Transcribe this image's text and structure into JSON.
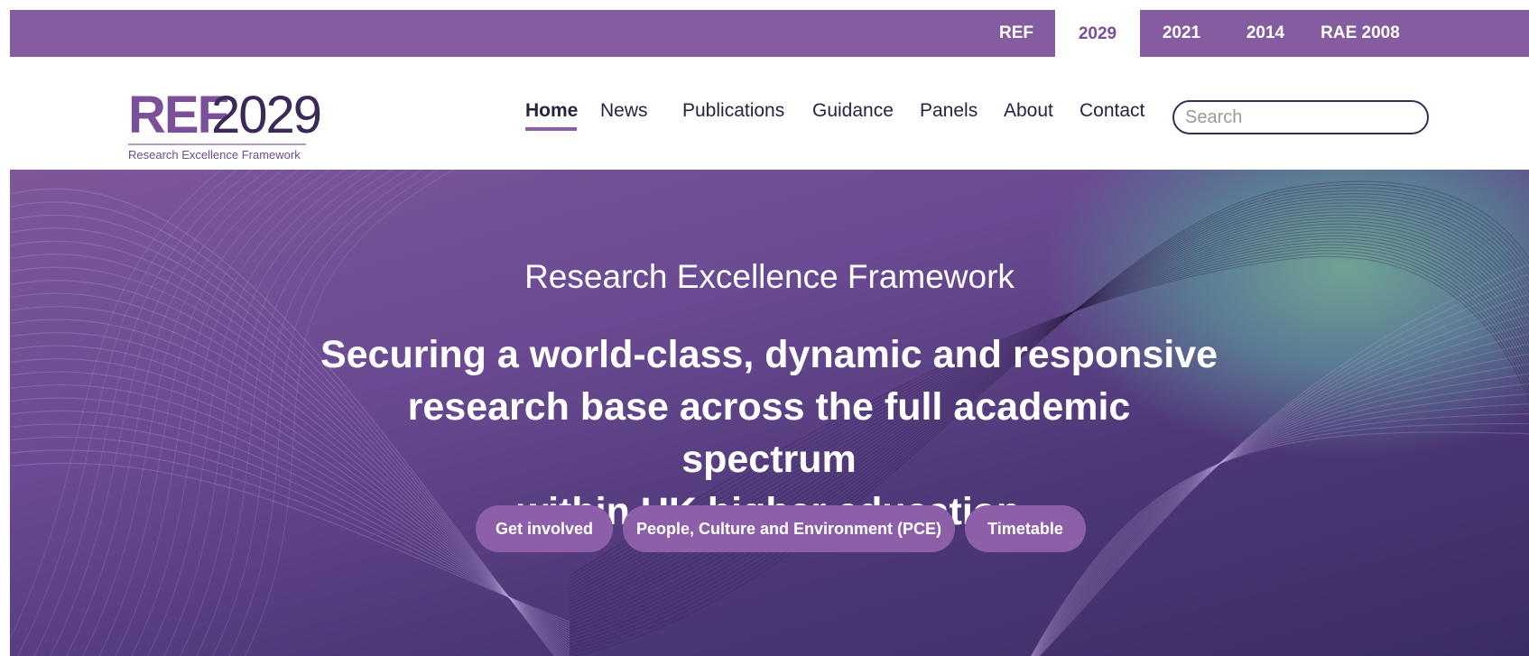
{
  "topbar": {
    "tabs": [
      {
        "label": "REF"
      },
      {
        "label": "2029"
      },
      {
        "label": "2021"
      },
      {
        "label": "2014"
      },
      {
        "label": "RAE 2008"
      }
    ],
    "active_tab": "2029"
  },
  "logo": {
    "ref": "REF",
    "year": "2029",
    "tagline": "Research Excellence Framework"
  },
  "nav": {
    "items": [
      {
        "label": "Home"
      },
      {
        "label": "News"
      },
      {
        "label": "Publications"
      },
      {
        "label": "Guidance"
      },
      {
        "label": "Panels"
      },
      {
        "label": "About"
      },
      {
        "label": "Contact"
      }
    ],
    "active": "Home"
  },
  "search": {
    "placeholder": "Search",
    "value": ""
  },
  "hero": {
    "subtitle": "Research Excellence Framework",
    "headline_lines": [
      "Securing a world-class, dynamic and responsive",
      "research base across the full academic spectrum",
      "within UK higher education"
    ],
    "buttons": [
      {
        "label": "Get involved"
      },
      {
        "label": "People, Culture and Environment (PCE)"
      },
      {
        "label": "Timetable"
      }
    ]
  },
  "colors": {
    "brand_purple": "#855c9f",
    "nav_text": "#2c2240",
    "button_purple": "#8d5fa9",
    "hero_dark": "#3c2c64",
    "hero_teal": "#6fa294"
  }
}
